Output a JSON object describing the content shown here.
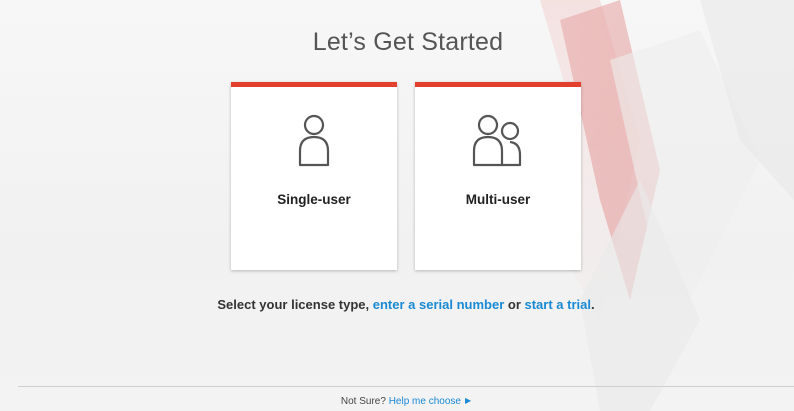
{
  "header": {
    "title": "Let’s Get Started"
  },
  "cards": [
    {
      "label": "Single-user",
      "icon": "single-user-icon"
    },
    {
      "label": "Multi-user",
      "icon": "multi-user-icon"
    }
  ],
  "license_prompt": {
    "text": "Select your license type,",
    "serial_link": "enter a serial number",
    "or_text": "or",
    "trial_link": "start a trial",
    "end": "."
  },
  "footer": {
    "not_sure": "Not Sure?",
    "help_link": "Help me choose",
    "arrow_icon": "caret-right-icon"
  },
  "colors": {
    "accent_red": "#e2402c",
    "link_blue": "#1a8ad4"
  }
}
